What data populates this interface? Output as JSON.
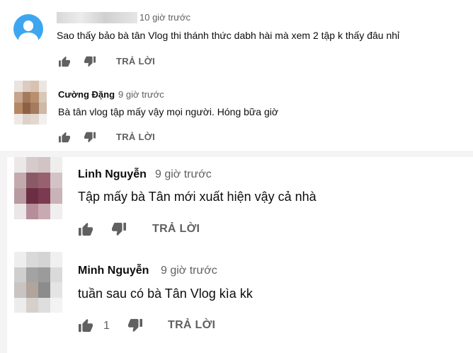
{
  "comments": [
    {
      "author": "",
      "time": "10 giờ trước",
      "text": "Sao thấy bảo bà tân Vlog  thi thánh thức dabh hài mà xem 2 tập k thấy đâu nhỉ",
      "reply_label": "TRẢ LỜI",
      "likes": "",
      "avatar": "default-user-icon"
    },
    {
      "author": "Cường Đặng",
      "time": "9 giờ trước",
      "text": "Bà tân vlog tập mấy vậy mọi người.  Hóng bữa giờ",
      "reply_label": "TRẢ LỜI",
      "likes": "",
      "avatar": "pixelated-avatar"
    },
    {
      "author": "Linh Nguyễn",
      "time": "9 giờ trước",
      "text": "Tập mấy bà Tân mới xuất hiện vậy cả nhà",
      "reply_label": "TRẢ LỜI",
      "likes": "",
      "avatar": "pixelated-avatar"
    },
    {
      "author": "Minh Nguyễn",
      "time": "9 giờ trước",
      "text": "tuần sau có bà Tân Vlog kìa kk",
      "reply_label": "TRẢ LỜI",
      "likes": "1",
      "avatar": "pixelated-avatar"
    }
  ],
  "colors": {
    "background": "#f4f4f4",
    "panel": "#ffffff",
    "text": "#0d0d0d",
    "meta": "#606060",
    "avatar_blue": "#3ea6f0"
  }
}
